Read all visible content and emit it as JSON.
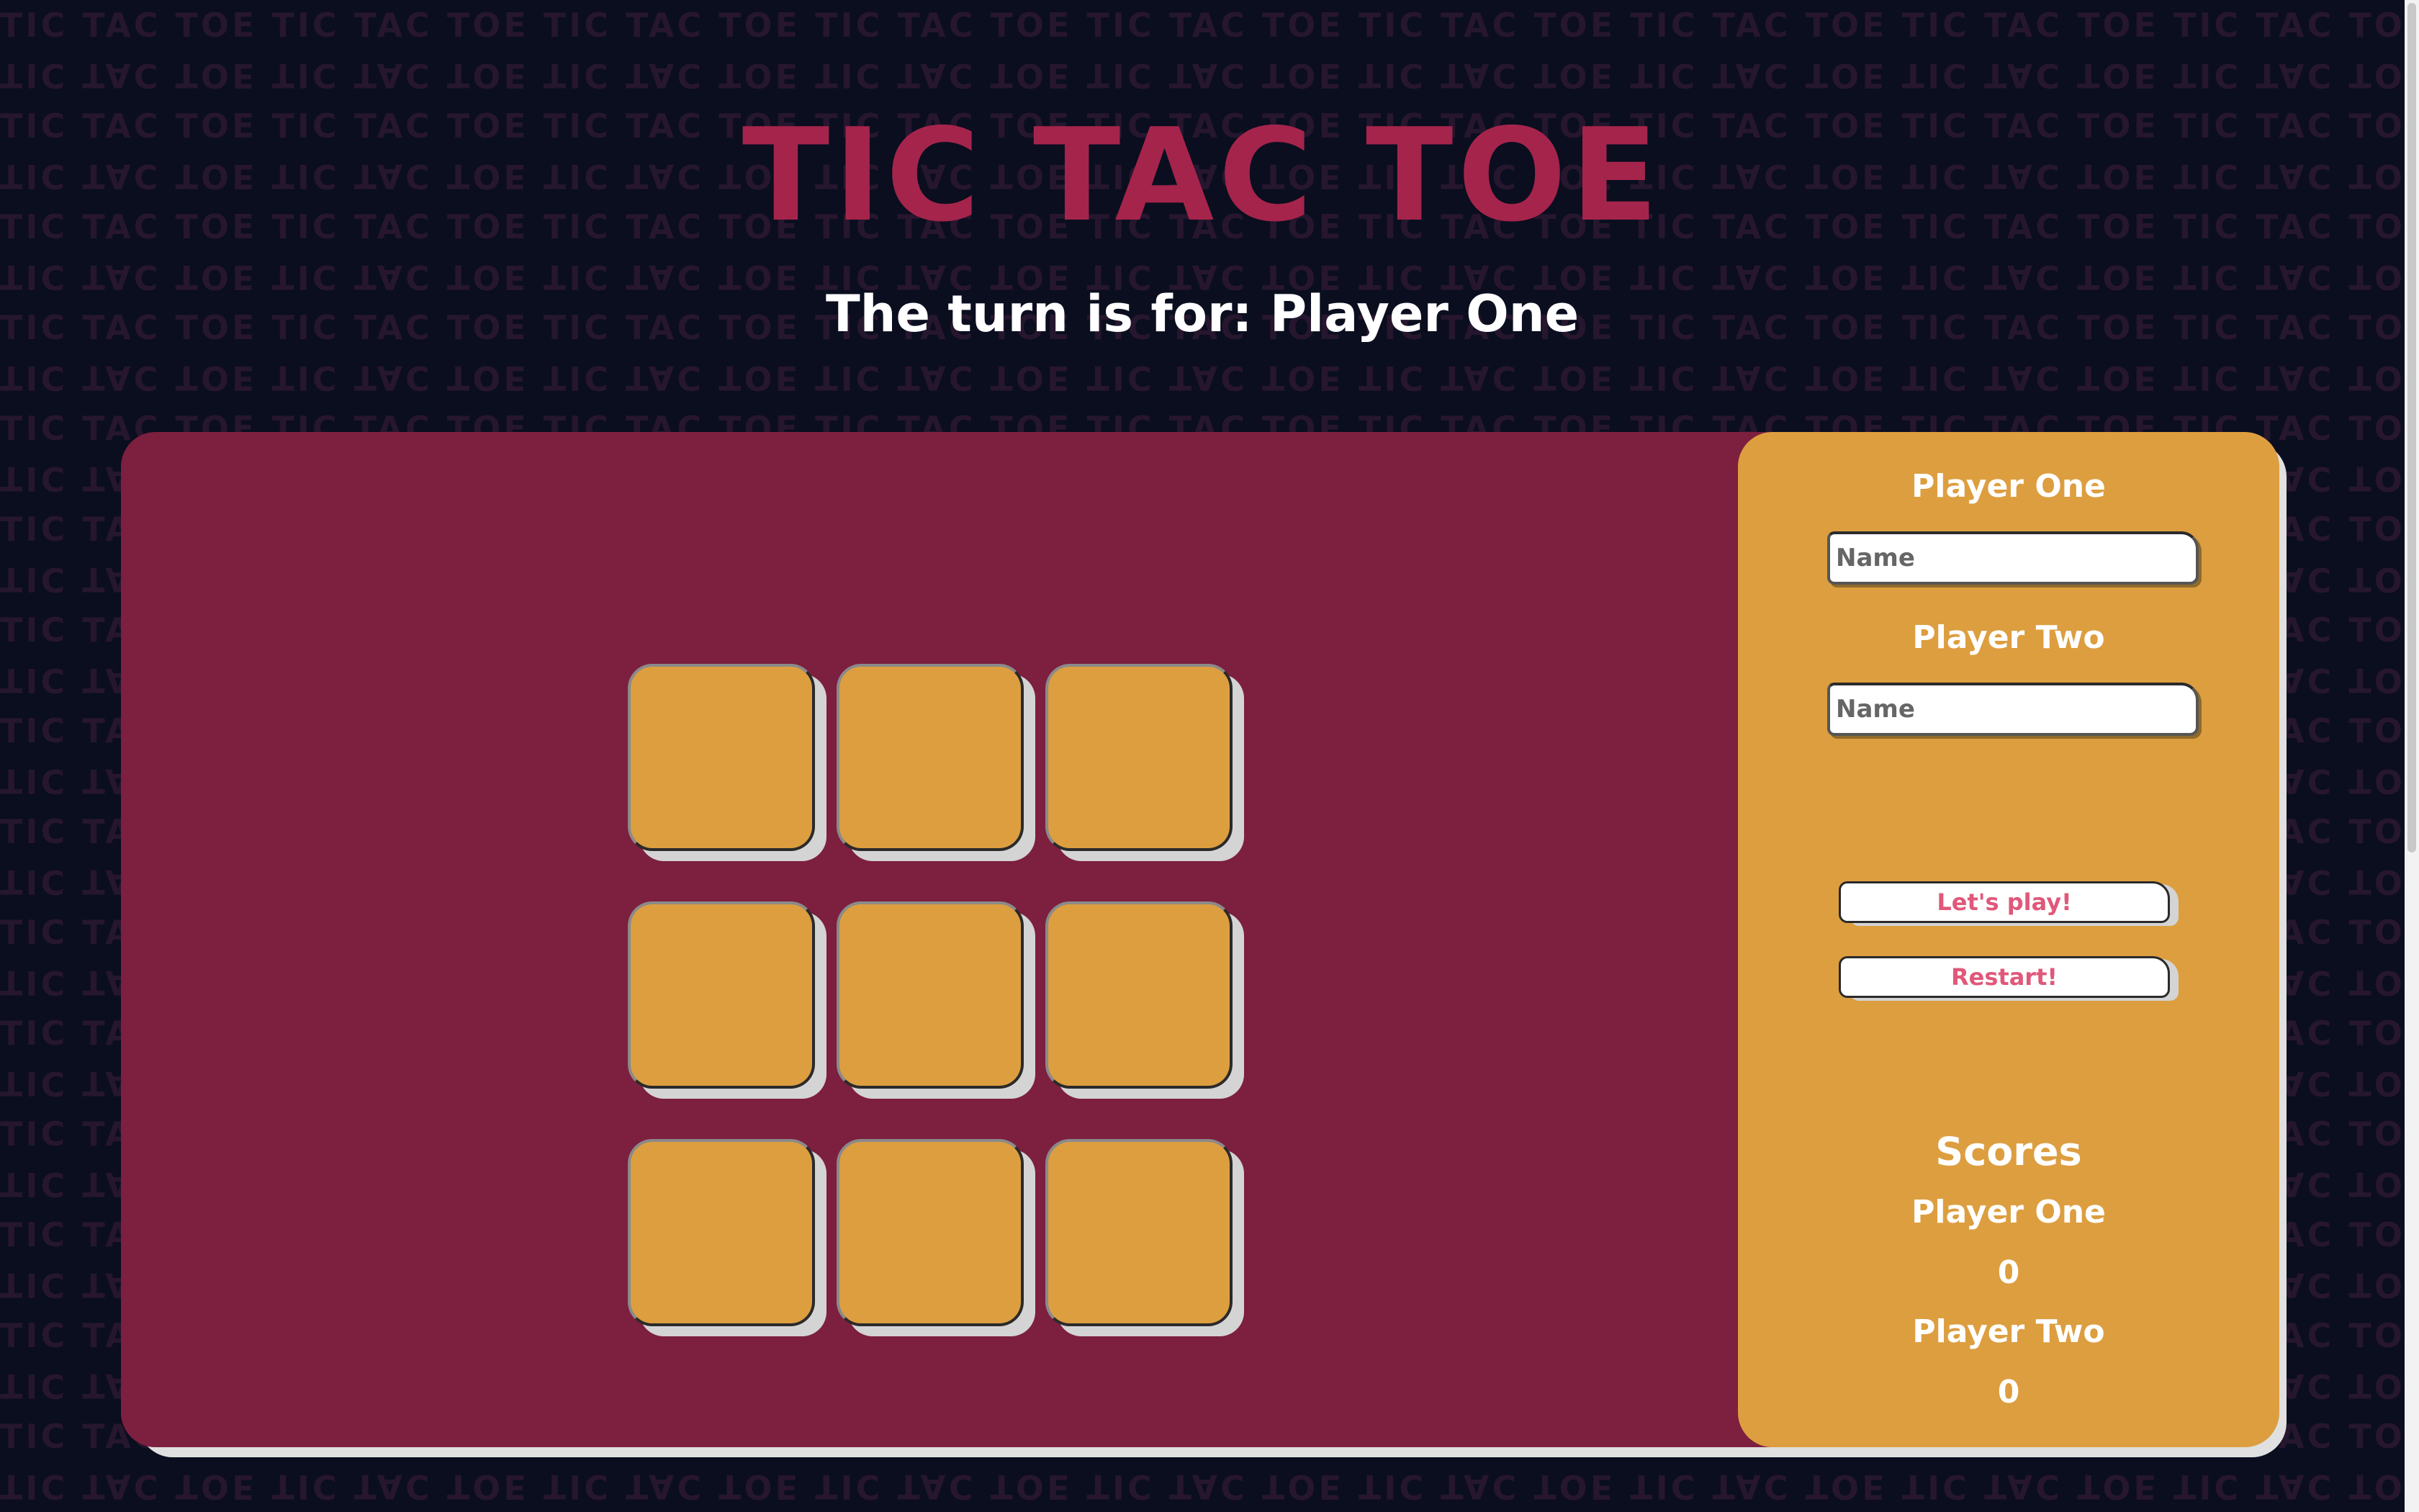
{
  "background_text": "TIC TAC TOE",
  "title": "TIC TAC TOE",
  "turn_text": "The turn is for: Player One",
  "board": {
    "cells": [
      "",
      "",
      "",
      "",
      "",
      "",
      "",
      "",
      ""
    ]
  },
  "sidebar": {
    "player_one_label": "Player One",
    "player_one_placeholder": "Name",
    "player_one_value": "",
    "player_two_label": "Player Two",
    "player_two_placeholder": "Name",
    "player_two_value": "",
    "play_button_label": "Let's play!",
    "restart_button_label": "Restart!",
    "scores": {
      "heading": "Scores",
      "player_one_label": "Player One",
      "player_one_score": "0",
      "player_two_label": "Player Two",
      "player_two_score": "0"
    }
  },
  "colors": {
    "page_background": "#0a0e1f",
    "title": "#a5244b",
    "game_area": "#7d1f3e",
    "cell": "#dd9e40",
    "sidebar": "#dd9e40",
    "button_text": "#e0587a"
  }
}
